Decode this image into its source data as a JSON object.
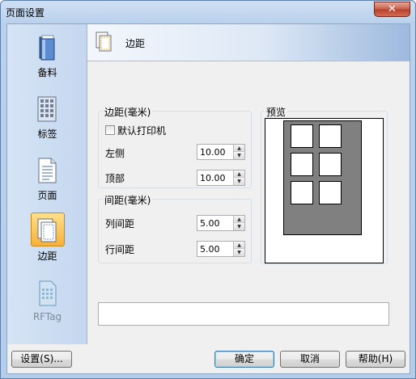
{
  "window": {
    "title": "页面设置",
    "close_glyph": "✕"
  },
  "sidebar": {
    "items": [
      {
        "label": "备料",
        "icon": "book-icon"
      },
      {
        "label": "标签",
        "icon": "label-sheet-icon"
      },
      {
        "label": "页面",
        "icon": "page-icon"
      },
      {
        "label": "边距",
        "icon": "margins-icon",
        "active": true
      },
      {
        "label": "RFTag",
        "icon": "rftag-icon",
        "disabled": true
      }
    ]
  },
  "header": {
    "title": "边距"
  },
  "margins": {
    "group_title": "边距(毫米)",
    "default_printer_label": "默认打印机",
    "default_printer_checked": false,
    "left_label": "左侧",
    "left_value": "10.00",
    "top_label": "顶部",
    "top_value": "10.00"
  },
  "spacing": {
    "group_title": "间距(毫米)",
    "column_label": "列间距",
    "column_value": "5.00",
    "row_label": "行间距",
    "row_value": "5.00"
  },
  "preview": {
    "title": "预览",
    "page_color": "#808080",
    "rows": 3,
    "columns": 2
  },
  "description_text": "",
  "buttons": {
    "settings": "设置(S)...",
    "ok": "确定",
    "cancel": "取消",
    "help": "帮助(H)"
  }
}
